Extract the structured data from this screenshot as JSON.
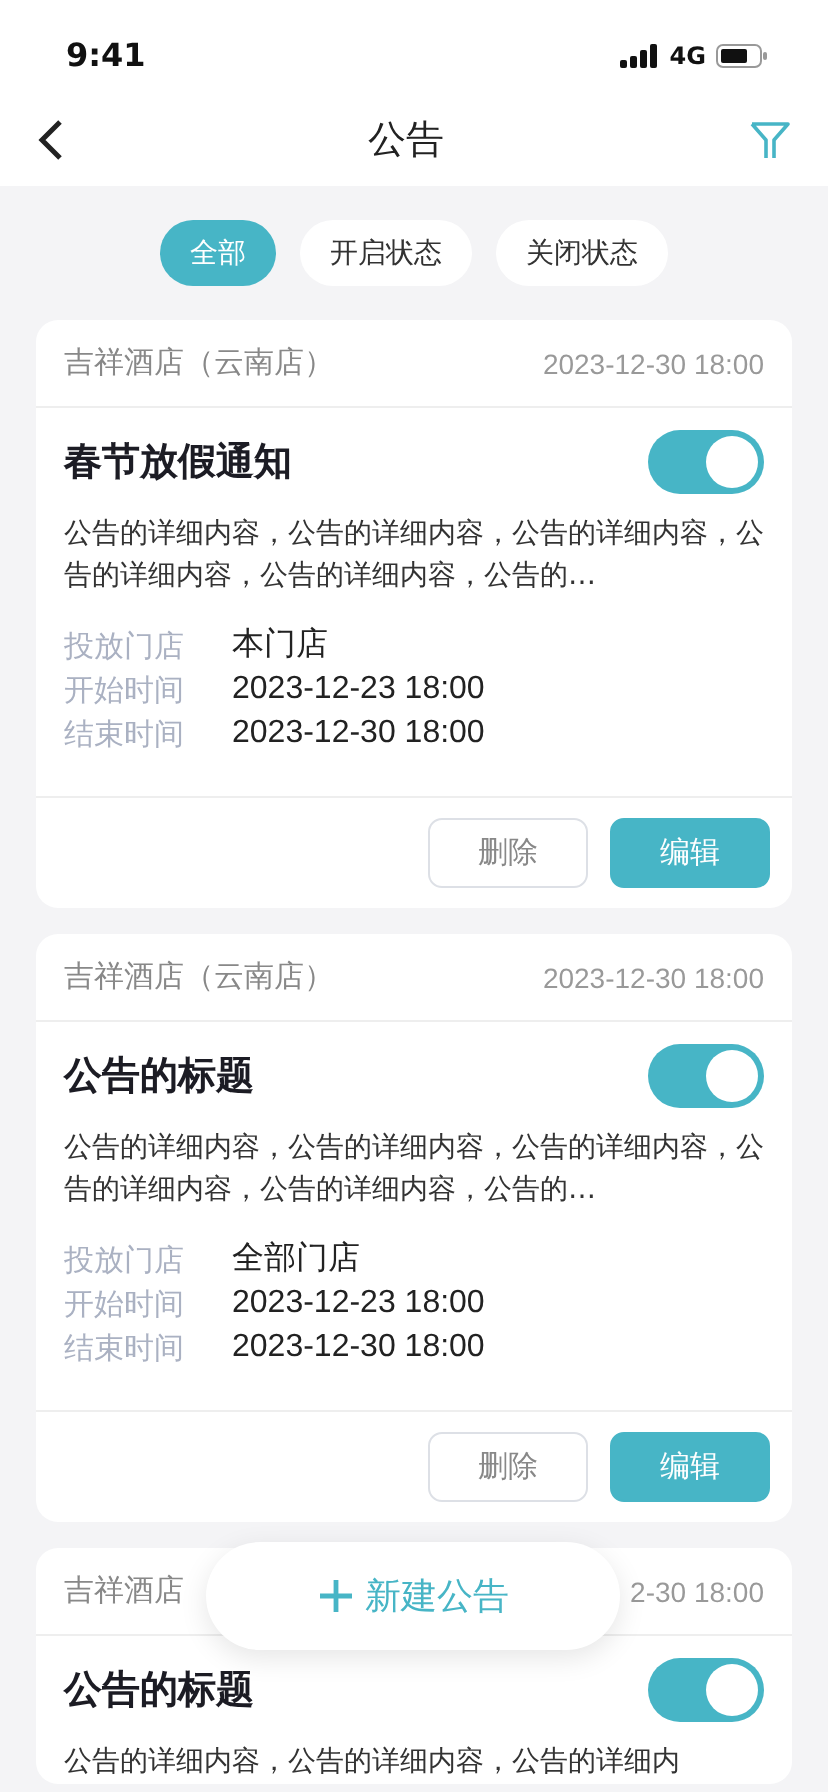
{
  "status_bar": {
    "time": "9:41",
    "network": "4G"
  },
  "nav": {
    "title": "公告"
  },
  "chips": [
    {
      "label": "全部",
      "selected": true
    },
    {
      "label": "开启状态",
      "selected": false
    },
    {
      "label": "关闭状态",
      "selected": false
    }
  ],
  "cards": [
    {
      "store": "吉祥酒店（云南店）",
      "time": "2023-12-30 18:00",
      "title": "春节放假通知",
      "on": true,
      "body": "公告的详细内容，公告的详细内容，公告的详细内容，公告的详细内容，公告的详细内容，公告的…",
      "info": [
        {
          "label": "投放门店",
          "value": "本门店"
        },
        {
          "label": "开始时间",
          "value": "2023-12-23 18:00"
        },
        {
          "label": "结束时间",
          "value": "2023-12-30 18:00"
        }
      ],
      "buttons": [
        "删除",
        "编辑"
      ]
    },
    {
      "store": "吉祥酒店（云南店）",
      "time": "2023-12-30 18:00",
      "title": "公告的标题",
      "on": true,
      "body": "公告的详细内容，公告的详细内容，公告的详细内容，公告的详细内容，公告的详细内容，公告的…",
      "info": [
        {
          "label": "投放门店",
          "value": "全部门店"
        },
        {
          "label": "开始时间",
          "value": "2023-12-23 18:00"
        },
        {
          "label": "结束时间",
          "value": "2023-12-30 18:00"
        }
      ],
      "buttons": [
        "删除",
        "编辑"
      ]
    },
    {
      "store": "吉祥酒店",
      "time": "2-30 18:00",
      "title": "公告的标题",
      "on": true,
      "body": "公告的详细内容，公告的详细内容，公告的详细内"
    }
  ],
  "fab": {
    "label": "新建公告"
  }
}
